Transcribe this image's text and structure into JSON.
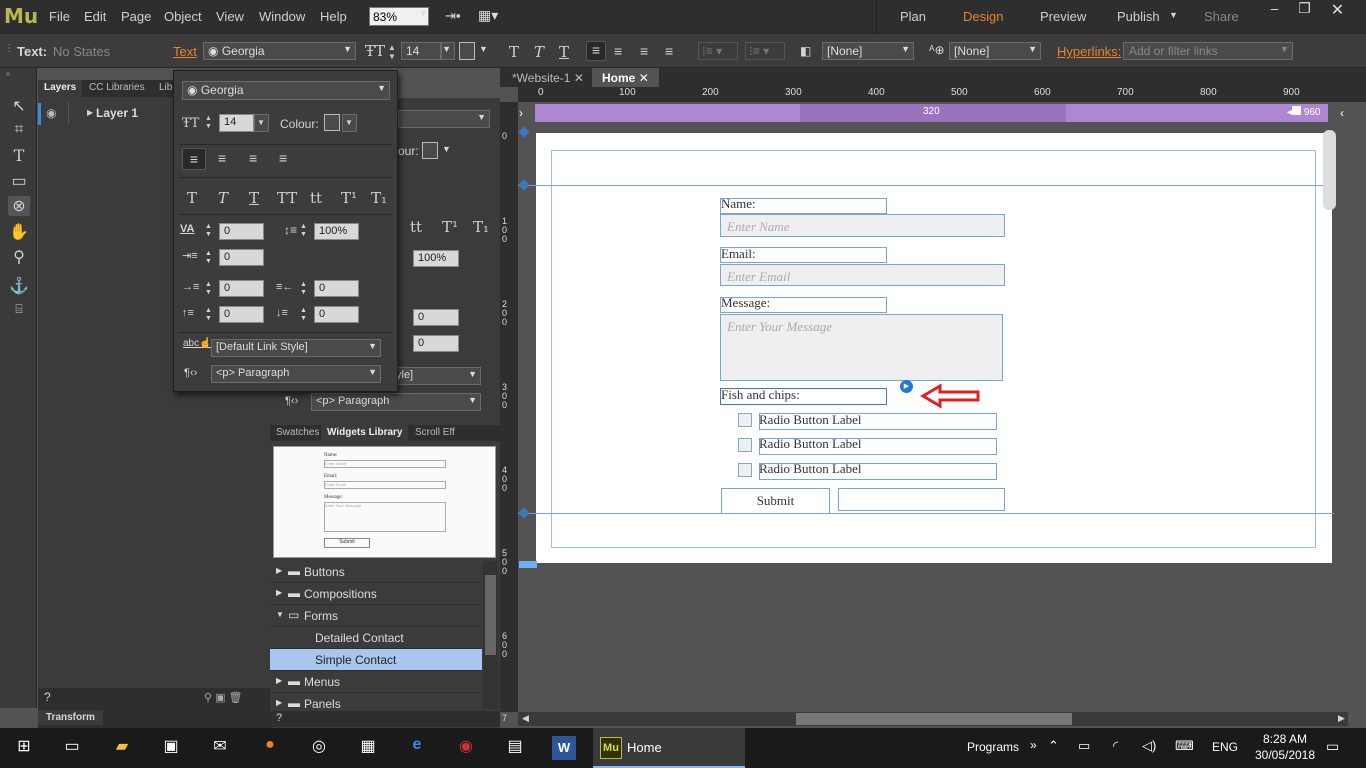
{
  "app": {
    "logo": "Mu",
    "menus": [
      "File",
      "Edit",
      "Page",
      "Object",
      "View",
      "Window",
      "Help"
    ],
    "zoom": "83%",
    "modes": [
      "Plan",
      "Design",
      "Preview",
      "Publish",
      "Share"
    ],
    "active_mode": "Design"
  },
  "toolbar": {
    "text_label": "Text:",
    "states": "No States",
    "text_link": "Text",
    "font": "Georgia",
    "size": "14",
    "style_none_1": "[None]",
    "style_none_2": "[None]",
    "hyperlinks_label": "Hyperlinks:",
    "hyperlinks_placeholder": "Add or filter links"
  },
  "left_panel": {
    "tabs": [
      "Layers",
      "CC Libraries",
      "Lib"
    ],
    "layer": "Layer 1",
    "transform": "Transform"
  },
  "text_panel": {
    "font": "Georgia",
    "size": "14",
    "colour_label": "Colour:",
    "tracking": "0",
    "leading": "100%",
    "indent_first": "0",
    "indent_left": "0",
    "indent_right": "0",
    "space_before": "0",
    "space_after": "0",
    "link_style": "[Default Link Style]",
    "paragraph": "<p> Paragraph",
    "colour_label_2": "our:",
    "leading_2": "100%",
    "space_2": "0",
    "space_3": "0",
    "link_style_2": "yle]",
    "paragraph_2": "<p> Paragraph"
  },
  "widgets": {
    "tabs": [
      "Swatches",
      "Widgets Library",
      "Scroll Eff"
    ],
    "items": [
      "Buttons",
      "Compositions",
      "Forms",
      "Detailed Contact",
      "Simple Contact",
      "Menus",
      "Panels"
    ],
    "preview": {
      "name": "Name:",
      "email": "Email:",
      "message": "Message:",
      "name_ph": "Enter Name",
      "email_ph": "Enter Email",
      "message_ph": "Enter Your Message",
      "submit": "Submit"
    }
  },
  "doc_tabs": [
    "*Website-1",
    "Home"
  ],
  "ruler": {
    "h": [
      "0",
      "100",
      "200",
      "300",
      "400",
      "500",
      "600",
      "700",
      "800",
      "900"
    ],
    "v": [
      "0",
      "1 0 0",
      "2 0 0",
      "3 0 0",
      "4 0 0",
      "5 0 0",
      "6 0 0",
      "7"
    ]
  },
  "breakpoint": {
    "mid": "320",
    "max": "960"
  },
  "form": {
    "name_label": "Name:",
    "name_ph": "Enter Name",
    "email_label": "Email:",
    "email_ph": "Enter Email",
    "message_label": "Message:",
    "message_ph": "Enter Your Message",
    "custom_label": "Fish and chips:",
    "radios": [
      "Radio Button Label",
      "Radio Button Label",
      "Radio Button Label"
    ],
    "submit": "Submit"
  },
  "taskbar": {
    "app_label": "Home",
    "programs": "Programs",
    "lang": "ENG",
    "time": "8:28 AM",
    "date": "30/05/2018"
  },
  "colors": {
    "accent": "#e8842c",
    "breakpoint": "#ae86d1",
    "selection": "#7aa4d4",
    "arrow": "#e02020"
  }
}
